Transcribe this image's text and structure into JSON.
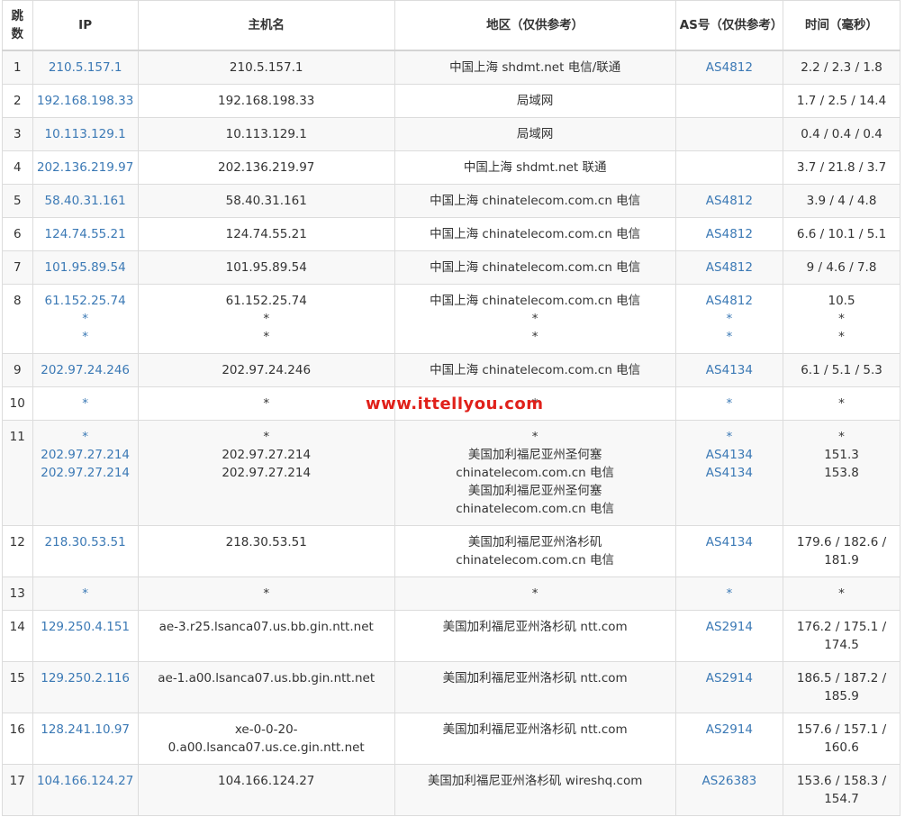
{
  "headers": {
    "hop": "跳数",
    "ip": "IP",
    "host": "主机名",
    "region": "地区（仅供参考）",
    "asn": "AS号（仅供参考）",
    "time": "时间（毫秒）"
  },
  "rows": [
    {
      "hop": "1",
      "ip": [
        "210.5.157.1"
      ],
      "host": [
        "210.5.157.1"
      ],
      "region": [
        "中国上海 shdmt.net 电信/联通"
      ],
      "asn": [
        "AS4812"
      ],
      "time": [
        "2.2 / 2.3 / 1.8"
      ]
    },
    {
      "hop": "2",
      "ip": [
        "192.168.198.33"
      ],
      "host": [
        "192.168.198.33"
      ],
      "region": [
        "局域网"
      ],
      "asn": [],
      "time": [
        "1.7 / 2.5 / 14.4"
      ]
    },
    {
      "hop": "3",
      "ip": [
        "10.113.129.1"
      ],
      "host": [
        "10.113.129.1"
      ],
      "region": [
        "局域网"
      ],
      "asn": [],
      "time": [
        "0.4 / 0.4 / 0.4"
      ]
    },
    {
      "hop": "4",
      "ip": [
        "202.136.219.97"
      ],
      "host": [
        "202.136.219.97"
      ],
      "region": [
        "中国上海 shdmt.net 联通"
      ],
      "asn": [],
      "time": [
        "3.7 / 21.8 / 3.7"
      ]
    },
    {
      "hop": "5",
      "ip": [
        "58.40.31.161"
      ],
      "host": [
        "58.40.31.161"
      ],
      "region": [
        "中国上海 chinatelecom.com.cn 电信"
      ],
      "asn": [
        "AS4812"
      ],
      "time": [
        "3.9 / 4 / 4.8"
      ]
    },
    {
      "hop": "6",
      "ip": [
        "124.74.55.21"
      ],
      "host": [
        "124.74.55.21"
      ],
      "region": [
        "中国上海 chinatelecom.com.cn 电信"
      ],
      "asn": [
        "AS4812"
      ],
      "time": [
        "6.6 / 10.1 / 5.1"
      ]
    },
    {
      "hop": "7",
      "ip": [
        "101.95.89.54"
      ],
      "host": [
        "101.95.89.54"
      ],
      "region": [
        "中国上海 chinatelecom.com.cn 电信"
      ],
      "asn": [
        "AS4812"
      ],
      "time": [
        "9 / 4.6 / 7.8"
      ]
    },
    {
      "hop": "8",
      "ip": [
        "61.152.25.74",
        "*",
        "*"
      ],
      "host": [
        "61.152.25.74",
        "*",
        "*"
      ],
      "region": [
        "中国上海 chinatelecom.com.cn 电信",
        "*",
        "*"
      ],
      "asn": [
        "AS4812",
        "*",
        "*"
      ],
      "time": [
        "10.5",
        "*",
        "*"
      ]
    },
    {
      "hop": "9",
      "ip": [
        "202.97.24.246"
      ],
      "host": [
        "202.97.24.246"
      ],
      "region": [
        "中国上海 chinatelecom.com.cn 电信"
      ],
      "asn": [
        "AS4134"
      ],
      "time": [
        "6.1 / 5.1 / 5.3"
      ]
    },
    {
      "hop": "10",
      "ip": [
        "*"
      ],
      "host": [
        "*"
      ],
      "region": [
        "*"
      ],
      "asn": [
        "*"
      ],
      "time": [
        "*"
      ]
    },
    {
      "hop": "11",
      "ip": [
        "*",
        "202.97.27.214",
        "202.97.27.214"
      ],
      "host": [
        "*",
        "202.97.27.214",
        "202.97.27.214"
      ],
      "region": [
        "*",
        "美国加利福尼亚州圣何塞",
        "chinatelecom.com.cn 电信",
        "美国加利福尼亚州圣何塞",
        "chinatelecom.com.cn 电信"
      ],
      "asn": [
        "*",
        "AS4134",
        "AS4134"
      ],
      "time": [
        "*",
        "151.3",
        "153.8"
      ]
    },
    {
      "hop": "12",
      "ip": [
        "218.30.53.51"
      ],
      "host": [
        "218.30.53.51"
      ],
      "region": [
        "美国加利福尼亚州洛杉矶",
        "chinatelecom.com.cn 电信"
      ],
      "asn": [
        "AS4134"
      ],
      "time": [
        "179.6 / 182.6 /",
        "181.9"
      ]
    },
    {
      "hop": "13",
      "ip": [
        "*"
      ],
      "host": [
        "*"
      ],
      "region": [
        "*"
      ],
      "asn": [
        "*"
      ],
      "time": [
        "*"
      ]
    },
    {
      "hop": "14",
      "ip": [
        "129.250.4.151"
      ],
      "host": [
        "ae-3.r25.lsanca07.us.bb.gin.ntt.net"
      ],
      "region": [
        "美国加利福尼亚州洛杉矶 ntt.com"
      ],
      "asn": [
        "AS2914"
      ],
      "time": [
        "176.2 / 175.1 /",
        "174.5"
      ]
    },
    {
      "hop": "15",
      "ip": [
        "129.250.2.116"
      ],
      "host": [
        "ae-1.a00.lsanca07.us.bb.gin.ntt.net"
      ],
      "region": [
        "美国加利福尼亚州洛杉矶 ntt.com"
      ],
      "asn": [
        "AS2914"
      ],
      "time": [
        "186.5 / 187.2 /",
        "185.9"
      ]
    },
    {
      "hop": "16",
      "ip": [
        "128.241.10.97"
      ],
      "host": [
        "xe-0-0-20-",
        "0.a00.lsanca07.us.ce.gin.ntt.net"
      ],
      "region": [
        "美国加利福尼亚州洛杉矶 ntt.com"
      ],
      "asn": [
        "AS2914"
      ],
      "time": [
        "157.6 / 157.1 /",
        "160.6"
      ]
    },
    {
      "hop": "17",
      "ip": [
        "104.166.124.27"
      ],
      "host": [
        "104.166.124.27"
      ],
      "region": [
        "美国加利福尼亚州洛杉矶 wireshq.com"
      ],
      "asn": [
        "AS26383"
      ],
      "time": [
        "153.6 / 158.3 /",
        "154.7"
      ]
    }
  ],
  "watermark": "www.ittellyou.com",
  "colors": {
    "link": "#3b79b5",
    "watermark": "#e0201a",
    "row_alt": "#f8f8f8",
    "border": "#dcdcdc"
  }
}
